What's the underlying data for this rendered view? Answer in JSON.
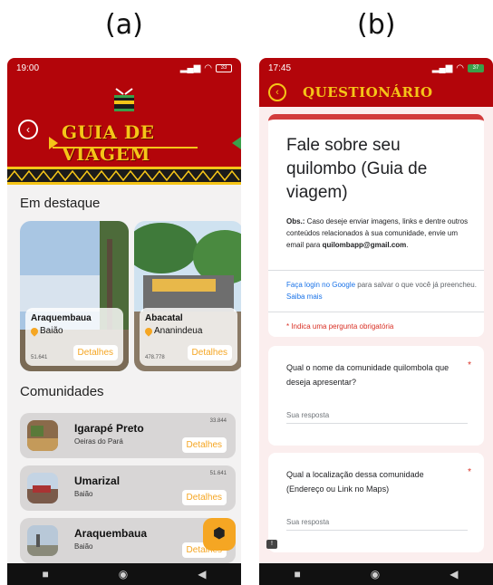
{
  "labels": {
    "a": "(a)",
    "b": "(b)"
  },
  "phone_a": {
    "status": {
      "time": "19:00",
      "battery": "33"
    },
    "title": "GUIA DE VIAGEM",
    "featured_title": "Em destaque",
    "featured": [
      {
        "name": "Araquembaua",
        "place": "Baião",
        "count": "51.641",
        "button": "Detalhes"
      },
      {
        "name": "Abacatal",
        "place": "Ananindeua",
        "count": "478.778",
        "button": "Detalhes"
      }
    ],
    "communities_title": "Comunidades",
    "communities": [
      {
        "name": "Igarapé Preto",
        "place": "Oeiras do Pará",
        "count": "33.844",
        "button": "Detalhes"
      },
      {
        "name": "Umarizal",
        "place": "Baião",
        "count": "51.641",
        "button": "Detalhes"
      },
      {
        "name": "Araquembaua",
        "place": "Baião",
        "count": "",
        "button": "Detalhes"
      }
    ],
    "colors": {
      "header": "#b3050a",
      "accent": "#f5a623",
      "gold": "#f5c518"
    }
  },
  "phone_b": {
    "status": {
      "time": "17:45",
      "battery": "37"
    },
    "title": "QUESTIONÁRIO",
    "form": {
      "heading": "Fale sobre seu quilombo (Guia de viagem)",
      "obs_label": "Obs.:",
      "obs_text": " Caso deseje enviar imagens, links e dentre outros conteúdos relacionados à sua comunidade, envie um email para ",
      "email": "quilombapp@gmail.com",
      "login_link": "Faça login no Google",
      "login_text": " para salvar o que você já preencheu. ",
      "more_link": "Saiba mais",
      "required_note": "* Indica uma pergunta obrigatória"
    },
    "questions": [
      {
        "text": "Qual o nome da comunidade quilombola que deseja apresentar?",
        "placeholder": "Sua resposta"
      },
      {
        "text": "Qual a localização dessa comunidade (Endereço ou Link no Maps)",
        "placeholder": "Sua resposta"
      }
    ]
  },
  "navbar": {
    "square": "■",
    "circle": "◉",
    "back": "◀"
  }
}
